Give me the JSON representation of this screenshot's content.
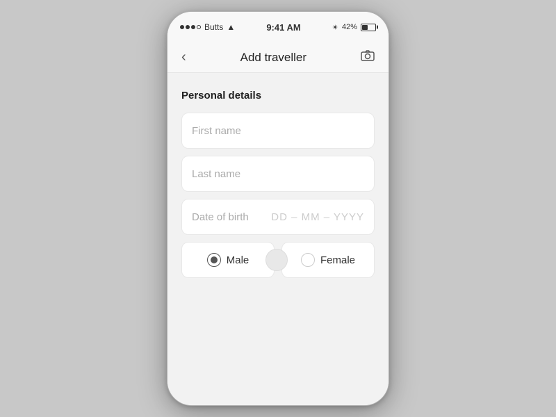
{
  "statusBar": {
    "carrier": "Butts",
    "time": "9:41 AM",
    "battery": "42%"
  },
  "navBar": {
    "title": "Add traveller",
    "backLabel": "‹",
    "cameraLabel": "📷"
  },
  "form": {
    "sectionTitle": "Personal details",
    "firstNamePlaceholder": "First name",
    "lastNamePlaceholder": "Last name",
    "dobLabel": "Date of birth",
    "dobPlaceholder": "DD – MM – YYYY",
    "genderOptions": [
      {
        "id": "male",
        "label": "Male",
        "selected": true
      },
      {
        "id": "female",
        "label": "Female",
        "selected": false
      }
    ]
  }
}
